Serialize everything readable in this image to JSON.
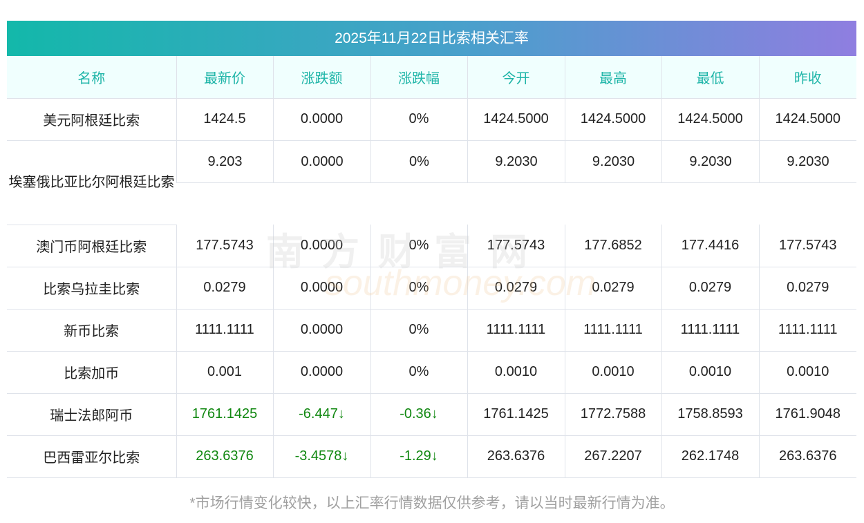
{
  "title": "2025年11月22日比索相关汇率",
  "headers": [
    "名称",
    "最新价",
    "涨跌额",
    "涨跌幅",
    "今开",
    "最高",
    "最低",
    "昨收"
  ],
  "rows": [
    [
      "美元阿根廷比索",
      "1424.5",
      "0.0000",
      "0%",
      "1424.5000",
      "1424.5000",
      "1424.5000",
      "1424.5000"
    ],
    [
      "埃塞俄比亚比尔阿根廷比索",
      "9.203",
      "0.0000",
      "0%",
      "9.2030",
      "9.2030",
      "9.2030",
      "9.2030"
    ],
    [
      "澳门币阿根廷比索",
      "177.5743",
      "0.0000",
      "0%",
      "177.5743",
      "177.6852",
      "177.4416",
      "177.5743"
    ],
    [
      "比索乌拉圭比索",
      "0.0279",
      "0.0000",
      "0%",
      "0.0279",
      "0.0279",
      "0.0279",
      "0.0279"
    ],
    [
      "新币比索",
      "1111.1111",
      "0.0000",
      "0%",
      "1111.1111",
      "1111.1111",
      "1111.1111",
      "1111.1111"
    ],
    [
      "比索加币",
      "0.001",
      "0.0000",
      "0%",
      "0.0010",
      "0.0010",
      "0.0010",
      "0.0010"
    ],
    [
      "瑞士法郎阿币",
      "1761.1425",
      "-6.447↓",
      "-0.36↓",
      "1761.1425",
      "1772.7588",
      "1758.8593",
      "1761.9048"
    ],
    [
      "巴西雷亚尔比索",
      "263.6376",
      "-3.4578↓",
      "-1.29↓",
      "263.6376",
      "267.2207",
      "262.1748",
      "263.6376"
    ]
  ],
  "down_rows": [
    6,
    7
  ],
  "colors": {
    "down": "#118811",
    "header_text": "#1fb5a8"
  },
  "note": "*市场行情变化较快，以上汇率行情数据仅供参考，请以当时最新行情为准。",
  "watermark": {
    "cn": "南方财富网",
    "en": "southmoney.com"
  }
}
